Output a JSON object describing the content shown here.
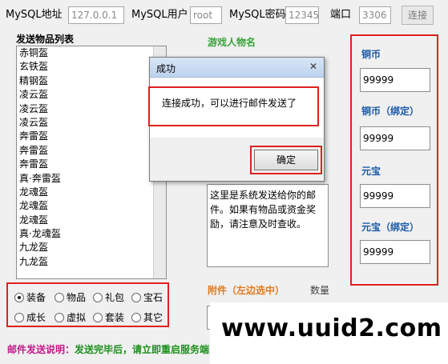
{
  "topbar": {
    "mysql_host_label": "MySQL地址",
    "mysql_host_value": "127.0.0.1",
    "mysql_user_label": "MySQL用户",
    "mysql_user_value": "root",
    "mysql_password_label": "MySQL密码",
    "mysql_password_value": "12345",
    "port_label": "端口",
    "port_value": "3306",
    "select_button": "连接"
  },
  "item_list": {
    "title": "发送物品列表",
    "items": [
      "赤铜盔",
      "玄铁盔",
      "精钢盔",
      "凌云盔",
      "凌云盔",
      "凌云盔",
      "奔雷盔",
      "奔雷盔",
      "奔雷盔",
      "真·奔雷盔",
      "龙魂盔",
      "龙魂盔",
      "龙魂盔",
      "真·龙魂盔",
      "九龙盔",
      "九龙盔"
    ]
  },
  "categories": {
    "options": [
      "装备",
      "物品",
      "礼包",
      "宝石",
      "成长",
      "虚拟",
      "套装",
      "其它"
    ],
    "selected": "装备"
  },
  "character": {
    "title": "游戏人物名"
  },
  "message": {
    "text": "这里是系统发送给你的邮件。如果有物品或资金奖励，请注意及时查收。"
  },
  "attachment": {
    "title": "附件（左边选中）",
    "quantity_label": "数量"
  },
  "currency": {
    "copper_label": "铜币",
    "copper_value": "99999",
    "copper_bound_label": "铜币（绑定）",
    "copper_bound_value": "99999",
    "yuanbao_label": "元宝",
    "yuanbao_value": "99999",
    "yuanbao_bound_label": "元宝（绑定）",
    "yuanbao_bound_value": "99999"
  },
  "bottom": {
    "note_label": "邮件发送说明：",
    "note_text": "发送完毕后，请立即重启服务端"
  },
  "watermark": {
    "text": "www.uuid2.com"
  },
  "dialog": {
    "title": "成功",
    "close_glyph": "✕",
    "message": "连接成功，可以进行邮件发送了",
    "ok_button": "确定"
  },
  "colors": {
    "highlight": "#e02020",
    "label_blue": "#1a5aa8",
    "green": "#3aa23a",
    "orange": "#e07a1a"
  }
}
